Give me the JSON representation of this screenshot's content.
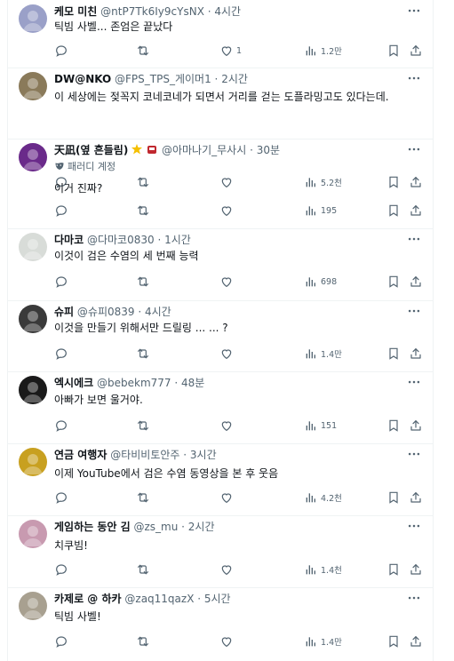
{
  "tweets": [
    {
      "name": "케모 미친",
      "handle": "@ntP7Tk6Iy9cYsNX",
      "time": "4시간",
      "text": "틱빔 사벨... 존엄은 끝났다",
      "replies": "",
      "retweets": "",
      "likes": "1",
      "views": "1.2만",
      "avatar_color": "#9aa0c8"
    },
    {
      "name": "DW@NKO",
      "handle": "@FPS_TPS_게이머1",
      "time": "2시간",
      "text": "이 세상에는 젖꼭지 코네코네가 되면서 거리를 걷는 도플라밍고도 있다는데.",
      "replies": "",
      "retweets": "",
      "likes": "",
      "views": "5.2천",
      "avatar_color": "#8a7a5a"
    },
    {
      "name": "天凪(옆 흔들림)",
      "handle": "@아마나기_무사시",
      "time": "30분",
      "parody": "패러디 계정",
      "text": "이거 진짜?",
      "replies": "",
      "retweets": "",
      "likes": "",
      "views": "195",
      "avatar_color": "#6a2a8a"
    },
    {
      "name": "다마코",
      "handle": "@다마코0830",
      "time": "1시간",
      "text": "이것이 검은 수염의 세 번째 능력",
      "replies": "",
      "retweets": "",
      "likes": "",
      "views": "698",
      "avatar_color": "#d8dcd8"
    },
    {
      "name": "슈피",
      "handle": "@슈피0839",
      "time": "4시간",
      "text": "이것을 만들기 위해서만 드릴링 ... ... ?",
      "replies": "",
      "retweets": "",
      "likes": "",
      "views": "1.4만",
      "avatar_color": "#3a3a3a"
    },
    {
      "name": "엑시에크",
      "handle": "@bebekm777",
      "time": "48분",
      "text": "아빠가 보면 울거야.",
      "replies": "",
      "retweets": "",
      "likes": "",
      "views": "151",
      "avatar_color": "#1a1a1a"
    },
    {
      "name": "연금 여행자",
      "handle": "@타비비토안주",
      "time": "3시간",
      "text": "이제 YouTube에서 검은 수염 동영상을 본 후 웃음",
      "replies": "",
      "retweets": "",
      "likes": "",
      "views": "4.2천",
      "avatar_color": "#c8a020"
    },
    {
      "name": "게임하는 동안 김",
      "handle": "@zs_mu",
      "time": "2시간",
      "text": "치쿠빔!",
      "replies": "",
      "retweets": "",
      "likes": "",
      "views": "1.4천",
      "avatar_color": "#c89ab0"
    },
    {
      "name": "카제로 @ 하카",
      "handle": "@zaq11qazX",
      "time": "5시간",
      "text": "틱빔 사벨!",
      "replies": "",
      "retweets": "",
      "likes": "",
      "views": "1.4만",
      "avatar_color": "#a8a090"
    }
  ]
}
